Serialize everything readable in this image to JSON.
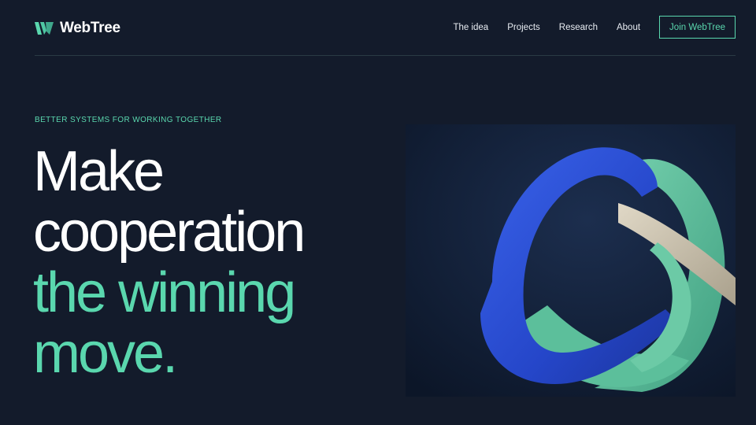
{
  "brand": {
    "name": "WebTree",
    "logo_icon": "webtree-w-logo-icon"
  },
  "nav": {
    "links": [
      "The idea",
      "Projects",
      "Research",
      "About"
    ],
    "cta": "Join WebTree"
  },
  "hero": {
    "eyebrow": "BETTER SYSTEMS FOR WORKING TOGETHER",
    "headline_lines": [
      "Make",
      "cooperation",
      "the winning",
      "move."
    ],
    "image": "intertwined-ribbon-sculpture"
  },
  "colors": {
    "background": "#131b2b",
    "accent": "#5ad7ae",
    "ribbon_blue": "#2a4fd6",
    "ribbon_green": "#5fbf9c",
    "ribbon_beige": "#cbc2ae"
  }
}
